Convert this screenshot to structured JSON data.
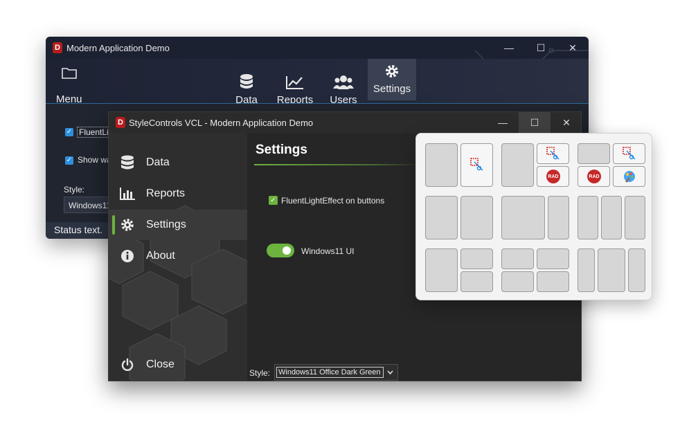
{
  "back_window": {
    "title": "Modern Application Demo",
    "logo_letter": "D",
    "menu_label": "Menu",
    "toolbar": [
      {
        "label": "Data",
        "icon": "database-icon"
      },
      {
        "label": "Reports",
        "icon": "chart-line-icon"
      },
      {
        "label": "Users",
        "icon": "users-icon"
      },
      {
        "label": "Settings",
        "icon": "gear-icon"
      }
    ],
    "checkbox_1": "FluentLig",
    "checkbox_2": "Show wa",
    "style_label": "Style:",
    "style_value": "Windows11",
    "status_text": "Status text.",
    "accent": "#2f8fde"
  },
  "front_window": {
    "title": "StyleControls VCL - Modern Application Demo",
    "logo_letter": "D",
    "sidebar": [
      {
        "label": "Data",
        "icon": "database-icon"
      },
      {
        "label": "Reports",
        "icon": "bar-chart-icon"
      },
      {
        "label": "Settings",
        "icon": "gear-icon"
      },
      {
        "label": "About",
        "icon": "info-icon"
      }
    ],
    "close_label": "Close",
    "heading": "Settings",
    "fluent_checkbox": "FluentLightEffect on buttons",
    "toggle_label": "Windows11 UI",
    "style_label": "Style:",
    "style_value": "Windows11 Office Dark Green",
    "accent": "#6cb33f"
  },
  "snap_popup": {
    "rad_label": "RAD"
  },
  "window_controls": {
    "minimize": "—",
    "maximize": "☐",
    "close": "✕"
  }
}
